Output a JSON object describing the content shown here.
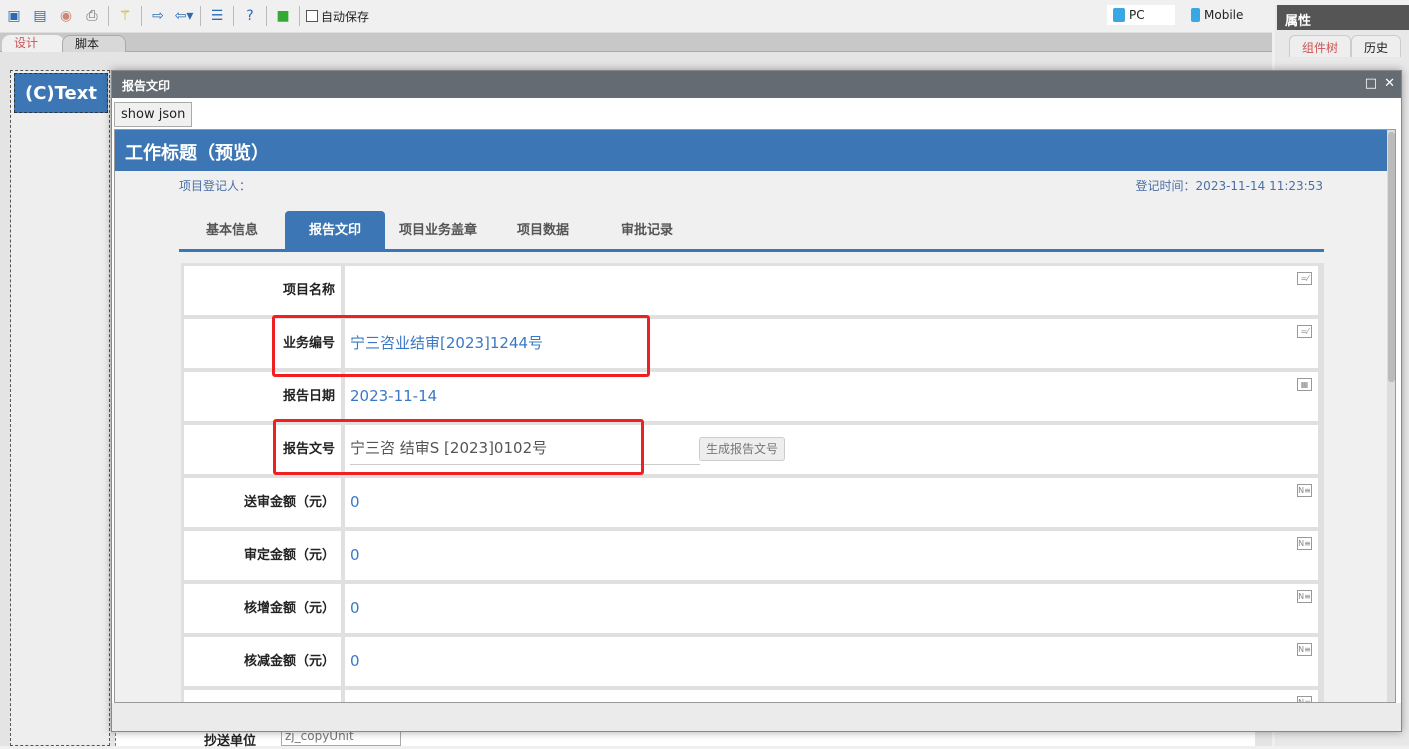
{
  "toolbar": {
    "icons": [
      "save-icon",
      "save-as-icon",
      "preview-icon",
      "print-icon",
      "wand-icon",
      "import-icon",
      "export-icon",
      "list-icon",
      "help-icon",
      "layers-icon"
    ],
    "autosave_label": "自动保存"
  },
  "device": {
    "pc": "PC",
    "mobile": "Mobile"
  },
  "editor_tabs": [
    "设计",
    "脚本"
  ],
  "canvas": {
    "text_component": "(C)Text",
    "copy_unit_label": "抄送单位",
    "copy_unit_field": "zj_copyUnit"
  },
  "right_panel": {
    "title": "属性",
    "tabs": [
      "组件树",
      "历史"
    ]
  },
  "dialog": {
    "title": "报告文印",
    "show_json": "show json",
    "header": "工作标题（预览）",
    "registrant": "项目登记人：",
    "reg_time": "登记时间：2023-11-14 11:23:53",
    "tabs": [
      "基本信息",
      "报告文印",
      "项目业务盖章",
      "项目数据",
      "审批记录"
    ],
    "active_tab": "报告文印",
    "rows": [
      {
        "label": "项目名称",
        "value": "",
        "icon": "edit-icon"
      },
      {
        "label": "业务编号",
        "value": "宁三咨业结审[2023]1244号",
        "icon": "edit-icon"
      },
      {
        "label": "报告日期",
        "value": "2023-11-14",
        "icon": "calendar-icon"
      },
      {
        "label": "报告文号",
        "value": "宁三咨 结审S [2023]0102号",
        "icon": "",
        "button": "生成报告文号"
      },
      {
        "label": "送审金额（元）",
        "value": "0",
        "icon": "number-icon"
      },
      {
        "label": "审定金额（元）",
        "value": "0",
        "icon": "number-icon"
      },
      {
        "label": "核增金额（元）",
        "value": "0",
        "icon": "number-icon"
      },
      {
        "label": "核减金额（元）",
        "value": "0",
        "icon": "number-icon"
      },
      {
        "label": "",
        "value": "",
        "icon": "number-icon"
      }
    ],
    "highlight_color": "#f02020",
    "accent": "#3c76b4"
  }
}
